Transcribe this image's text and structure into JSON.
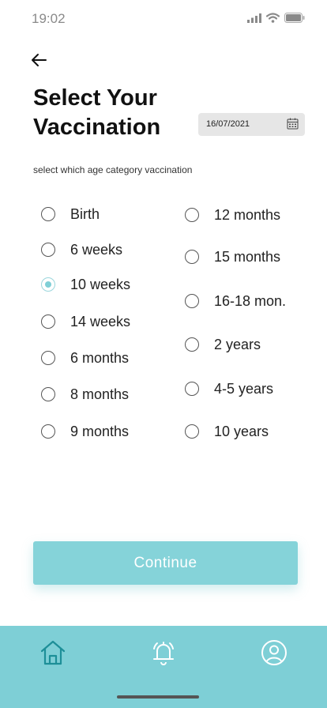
{
  "status_bar": {
    "time": "19:02",
    "icons": [
      "signal-icon",
      "wifi-icon",
      "battery-icon"
    ]
  },
  "header": {
    "back_icon": "arrow-left-icon",
    "title": "Select Your Vaccination",
    "date": {
      "value": "16/07/2021",
      "icon": "calendar-icon"
    }
  },
  "subtitle": "select which age category vaccination",
  "options": {
    "left": [
      {
        "label": "Birth",
        "checked": false
      },
      {
        "label": "6 weeks",
        "checked": false
      },
      {
        "label": "10 weeks",
        "checked": true
      },
      {
        "label": "14 weeks",
        "checked": false
      },
      {
        "label": "6 months",
        "checked": false
      },
      {
        "label": "8 months",
        "checked": false
      },
      {
        "label": "9 months",
        "checked": false
      }
    ],
    "right": [
      {
        "label": "12 months",
        "checked": false
      },
      {
        "label": "15 months",
        "checked": false
      },
      {
        "label": "16-18 mon.",
        "checked": false
      },
      {
        "label": "2 years",
        "checked": false
      },
      {
        "label": "4-5 years",
        "checked": false
      },
      {
        "label": "10 years",
        "checked": false
      }
    ]
  },
  "continue_label": "Continue",
  "bottom_nav": {
    "items": [
      "home-icon",
      "alarm-bell-icon",
      "profile-icon"
    ]
  },
  "colors": {
    "accent": "#7ecfd6",
    "button": "#85d3d9",
    "radio_checked": "#7fcfd6"
  }
}
